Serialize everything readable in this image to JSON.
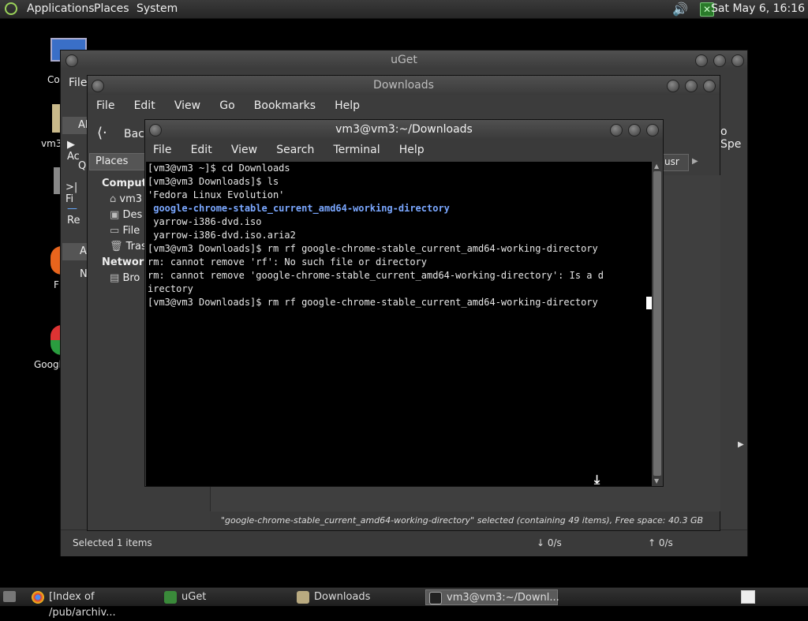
{
  "top_panel": {
    "menus": [
      "Applications",
      "Places",
      "System"
    ],
    "clock": "Sat May  6, 16:16"
  },
  "desktop": {
    "icons": [
      "Co",
      "vm3",
      "F",
      "Googl"
    ]
  },
  "uget": {
    "title": "uGet",
    "menu_partial": "File",
    "sidebar_partial": [
      "Al",
      "Ac",
      "Q",
      "Fi",
      "Re",
      "A",
      "N"
    ],
    "speed_partial": "o Spe",
    "status_left": "Selected 1 items",
    "down_speed": "↓  0/s",
    "up_speed": "↑  0/s"
  },
  "nautilus": {
    "title": "Downloads",
    "menu": [
      "File",
      "Edit",
      "View",
      "Go",
      "Bookmarks",
      "Help"
    ],
    "back_label": "Back",
    "places_label": "Places",
    "path_partial": "usr",
    "sidebar_computer_heading": "Compute",
    "sidebar_computer_items": [
      "vm3",
      "Des",
      "File",
      "Tras"
    ],
    "sidebar_network_heading": "Network",
    "sidebar_network_items": [
      "Bro"
    ],
    "status": "\"google-chrome-stable_current_amd64-working-directory\" selected (containing 49 items), Free space: 40.3 GB"
  },
  "terminal": {
    "title": "vm3@vm3:~/Downloads",
    "menu": [
      "File",
      "Edit",
      "View",
      "Search",
      "Terminal",
      "Help"
    ],
    "lines": [
      {
        "text": "[vm3@vm3 ~]$ cd Downloads",
        "dir": false
      },
      {
        "text": "[vm3@vm3 Downloads]$ ls",
        "dir": false
      },
      {
        "text": "'Fedora Linux Evolution'",
        "dir": false
      },
      {
        "text": " google-chrome-stable_current_amd64-working-directory",
        "dir": true
      },
      {
        "text": " yarrow-i386-dvd.iso",
        "dir": false
      },
      {
        "text": " yarrow-i386-dvd.iso.aria2",
        "dir": false
      },
      {
        "text": "[vm3@vm3 Downloads]$ rm rf google-chrome-stable_current_amd64-working-directory",
        "dir": false
      },
      {
        "text": "rm: cannot remove 'rf': No such file or directory",
        "dir": false
      },
      {
        "text": "rm: cannot remove 'google-chrome-stable_current_amd64-working-directory': Is a d",
        "dir": false
      },
      {
        "text": "irectory",
        "dir": false
      },
      {
        "text": "[vm3@vm3 Downloads]$ rm rf google-chrome-stable_current_amd64-working-directory",
        "dir": false
      }
    ]
  },
  "taskbar": {
    "items": [
      "[Index of /pub/archiv...",
      "uGet",
      "Downloads",
      "vm3@vm3:~/Downl..."
    ]
  }
}
